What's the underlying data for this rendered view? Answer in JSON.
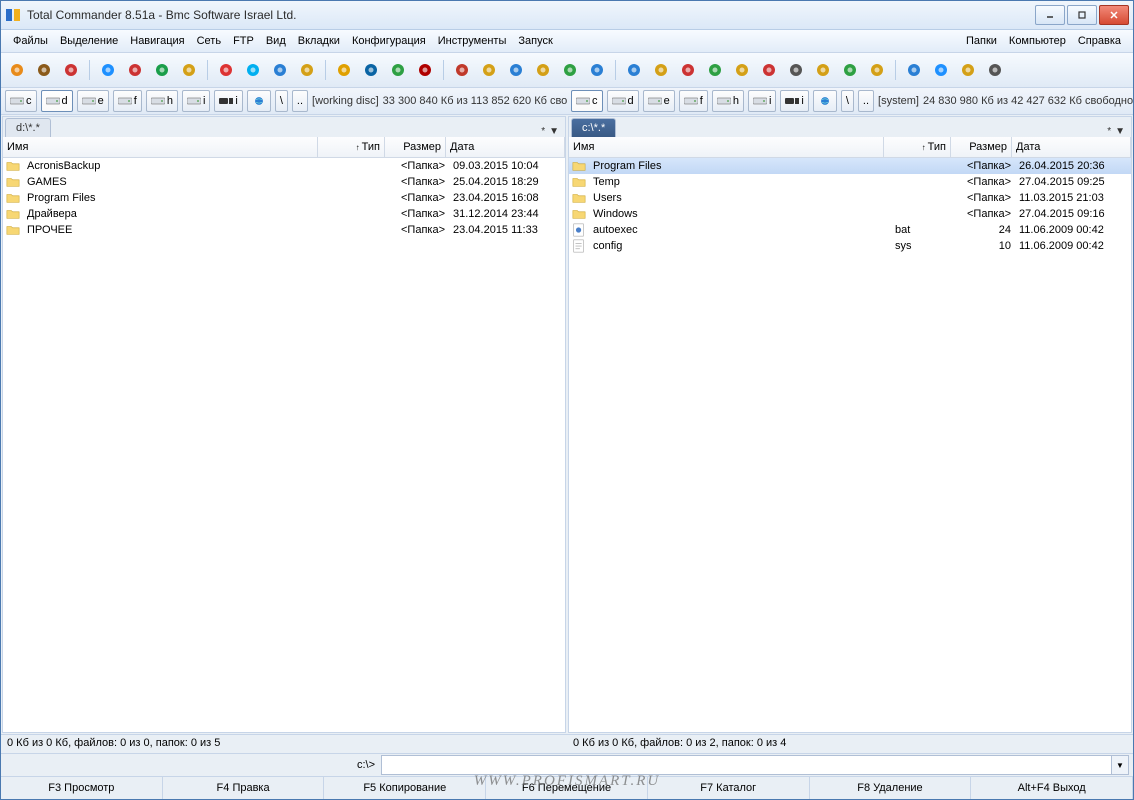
{
  "title": "Total Commander 8.51a - Bmc Software Israel Ltd.",
  "menu": {
    "items": [
      "Файлы",
      "Выделение",
      "Навигация",
      "Сеть",
      "FTP",
      "Вид",
      "Вкладки",
      "Конфигурация",
      "Инструменты",
      "Запуск"
    ],
    "right": [
      "Папки",
      "Компьютер",
      "Справка"
    ]
  },
  "drives": {
    "left": {
      "items": [
        {
          "l": "c"
        },
        {
          "l": "d",
          "active": true
        },
        {
          "l": "e"
        },
        {
          "l": "f"
        },
        {
          "l": "h"
        },
        {
          "l": "i"
        }
      ],
      "label": "[working disc]",
      "free": "33 300 840 Кб из 113 852 620 Кб сво"
    },
    "right": {
      "items": [
        {
          "l": "c",
          "active": true
        },
        {
          "l": "d"
        },
        {
          "l": "e"
        },
        {
          "l": "f"
        },
        {
          "l": "h"
        },
        {
          "l": "i"
        }
      ],
      "label": "[system]",
      "free": "24 830 980 Кб из 42 427 632 Кб свободно"
    }
  },
  "headers": {
    "name": "Имя",
    "type": "Тип",
    "size": "Размер",
    "date": "Дата",
    "sortArrow": "↑"
  },
  "left": {
    "tab": "d:\\*.*",
    "files": [
      {
        "icon": "folder",
        "name": "AcronisBackup",
        "type": "",
        "size": "<Папка>",
        "date": "09.03.2015 10:04"
      },
      {
        "icon": "folder",
        "name": "GAMES",
        "type": "",
        "size": "<Папка>",
        "date": "25.04.2015 18:29"
      },
      {
        "icon": "folder",
        "name": "Program Files",
        "type": "",
        "size": "<Папка>",
        "date": "23.04.2015 16:08"
      },
      {
        "icon": "folder",
        "name": "Драйвера",
        "type": "",
        "size": "<Папка>",
        "date": "31.12.2014 23:44"
      },
      {
        "icon": "folder",
        "name": "ПРОЧЕЕ",
        "type": "",
        "size": "<Папка>",
        "date": "23.04.2015 11:33"
      }
    ],
    "status": "0 Кб из 0 Кб, файлов: 0 из 0, папок: 0 из 5"
  },
  "right": {
    "tab": "c:\\*.*",
    "files": [
      {
        "icon": "folder",
        "name": "Program Files",
        "type": "",
        "size": "<Папка>",
        "date": "26.04.2015 20:36",
        "sel": true
      },
      {
        "icon": "folder",
        "name": "Temp",
        "type": "",
        "size": "<Папка>",
        "date": "27.04.2015 09:25"
      },
      {
        "icon": "folder",
        "name": "Users",
        "type": "",
        "size": "<Папка>",
        "date": "11.03.2015 21:03"
      },
      {
        "icon": "folder",
        "name": "Windows",
        "type": "",
        "size": "<Папка>",
        "date": "27.04.2015 09:16"
      },
      {
        "icon": "bat",
        "name": "autoexec",
        "type": "bat",
        "size": "24",
        "date": "11.06.2009 00:42"
      },
      {
        "icon": "sys",
        "name": "config",
        "type": "sys",
        "size": "10",
        "date": "11.06.2009 00:42"
      }
    ],
    "status": "0 Кб из 0 Кб, файлов: 0 из 2, папок: 0 из 4"
  },
  "cmdline": {
    "prompt": "c:\\>"
  },
  "fkeys": [
    "F3 Просмотр",
    "F4 Правка",
    "F5 Копирование",
    "F6 Перемещение",
    "F7 Каталог",
    "F8 Удаление",
    "Alt+F4 Выход"
  ],
  "watermark": "WWW.PROFISMART.RU"
}
